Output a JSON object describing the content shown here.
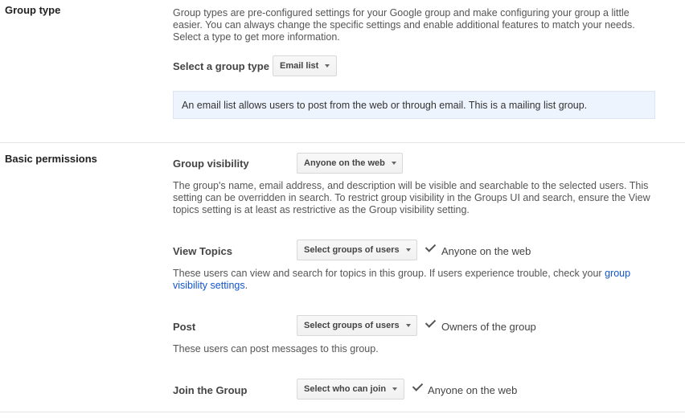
{
  "group_type": {
    "title": "Group type",
    "description": "Group types are pre-configured settings for your Google group and make configuring your group a little easier. You can always change the specific settings and enable additional features to match your needs. Select a type to get more information.",
    "select_label": "Select a group type",
    "selected": "Email list",
    "info": "An email list allows users to post from the web or through email. This is a mailing list group."
  },
  "basic_permissions": {
    "title": "Basic permissions",
    "visibility": {
      "label": "Group visibility",
      "selected": "Anyone on the web",
      "description": "The group's name, email address, and description will be visible and searchable to the selected users. This setting can be overridden in search. To restrict group visibility in the Groups UI and search, ensure the View topics setting is at least as restrictive as the Group visibility setting."
    },
    "view_topics": {
      "label": "View Topics",
      "dropdown": "Select groups of users",
      "value": "Anyone on the web",
      "description": "These users can view and search for topics in this group. If users experience trouble, check your ",
      "link": "group visibility settings",
      "description_end": "."
    },
    "post": {
      "label": "Post",
      "dropdown": "Select groups of users",
      "value": "Owners of the group",
      "description": "These users can post messages to this group."
    },
    "join": {
      "label": "Join the Group",
      "dropdown": "Select who can join",
      "value": "Anyone on the web"
    }
  }
}
